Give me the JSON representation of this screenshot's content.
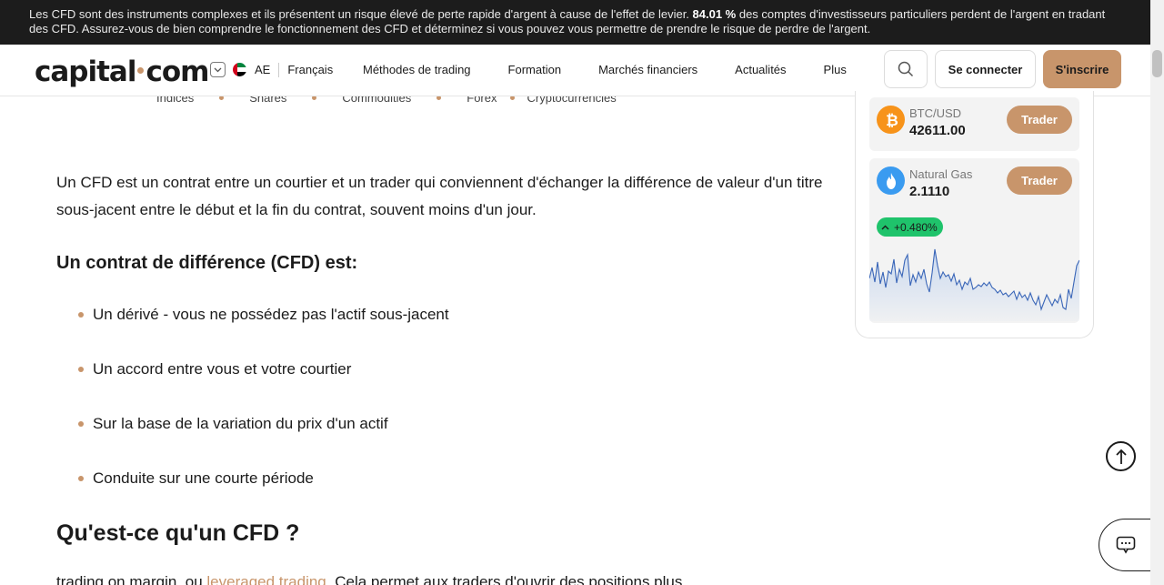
{
  "risk_banner": {
    "text_before": "Les CFD sont des instruments complexes et ils présentent un risque élevé de perte rapide d'argent à cause de l'effet de levier. ",
    "percentage": "84.01 %",
    "text_after": " des comptes d'investisseurs particuliers perdent de l'argent en tradant des CFD. Assurez-vous de bien comprendre le fonctionnement des CFD et déterminez si vous pouvez vous permettre de prendre le risque de perdre de l'argent."
  },
  "header": {
    "logo_left": "capital",
    "logo_right": "com",
    "region_code": "AE",
    "language": "Français",
    "nav": [
      "Méthodes de trading",
      "Formation",
      "Marchés financiers",
      "Actualités",
      "Plus"
    ],
    "login_label": "Se connecter",
    "signup_label": "S'inscrire"
  },
  "categories": [
    "Indices",
    "Shares",
    "Commodities",
    "Forex",
    "Cryptocurrencies"
  ],
  "article": {
    "intro": "Un CFD est un contrat entre un courtier et un trader qui conviennent d'échanger la différence de valeur d'un titre sous-jacent entre le début et la fin du contrat, souvent moins d'un jour.",
    "subheading": "Un contrat de différence (CFD) est:",
    "bullets": [
      "Un dérivé - vous ne possédez pas l'actif sous-jacent",
      "Un accord entre vous et votre courtier",
      "Sur la base de la variation du prix d'un actif",
      "Conduite sur une courte période"
    ],
    "heading": "Qu'est-ce qu'un CFD ?",
    "next_before": "trading on margin, ou ",
    "next_link": "leveraged trading",
    "next_after": ". Cela permet aux traders d'ouvrir des positions plus"
  },
  "widget": {
    "tickers": [
      {
        "name": "BTC/USD",
        "price": "42611.00",
        "trade_label": "Trader",
        "icon": "bitcoin-icon",
        "color": "#f7931a"
      },
      {
        "name": "Natural Gas",
        "price": "2.1110",
        "trade_label": "Trader",
        "icon": "flame-icon",
        "color": "#3a9bf0"
      }
    ],
    "change": "+0.480%",
    "change_color": "#1fc36b"
  },
  "colors": {
    "accent": "#c8956b",
    "banner_bg": "#1c1c1c"
  }
}
